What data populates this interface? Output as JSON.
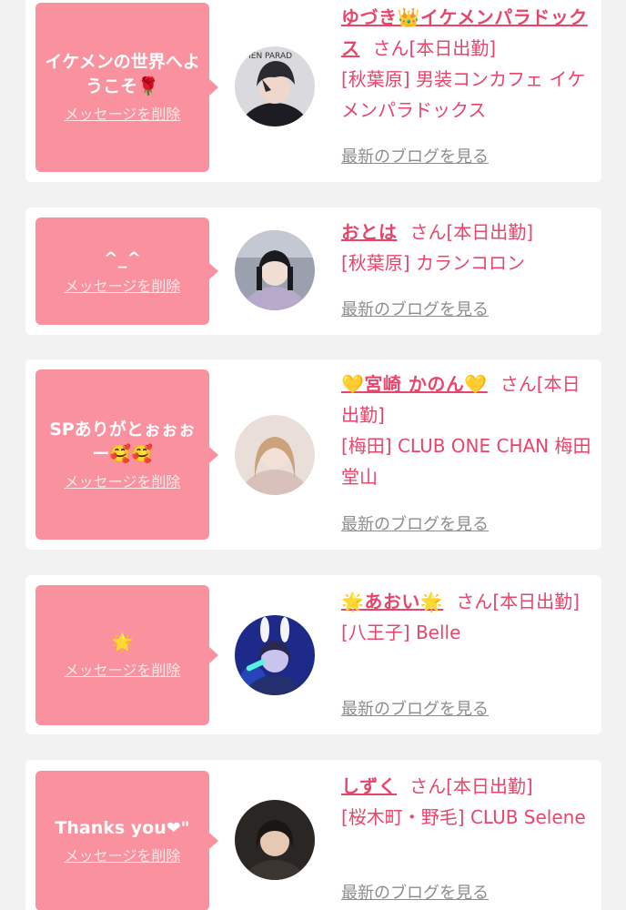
{
  "entries": [
    {
      "message": "イケメンの世界へようこそ🌹",
      "delete_label": "メッセージを削除",
      "name": "ゆづき👑イケメンパラドックス",
      "honorific": "さん",
      "status": "[本日出勤]",
      "shop": "[秋葉原] 男装コンカフェ イケメンパラドックス",
      "blog_label": "最新のブログを見る",
      "avatar_text": "MEN PARAD"
    },
    {
      "message": "^_^",
      "delete_label": "メッセージを削除",
      "name": "おとは",
      "honorific": "さん",
      "status": "[本日出勤]",
      "shop": "[秋葉原] カランコロン",
      "blog_label": "最新のブログを見る"
    },
    {
      "message": "SPありがとぉぉぉー🥰🥰",
      "delete_label": "メッセージを削除",
      "name": "💛宮崎 かのん💛",
      "honorific": "さん",
      "status": "[本日出勤]",
      "shop": "[梅田] CLUB ONE CHAN 梅田堂山",
      "blog_label": "最新のブログを見る"
    },
    {
      "message": "🌟",
      "delete_label": "メッセージを削除",
      "name": "🌟あおい🌟",
      "honorific": "さん",
      "status": "[本日出勤]",
      "shop": "[八王子] Belle",
      "blog_label": "最新のブログを見る"
    },
    {
      "message": "Thanks you❤\"",
      "delete_label": "メッセージを削除",
      "name": "しずく",
      "honorific": "さん",
      "status": "[本日出勤]",
      "shop": "[桜木町・野毛] CLUB Selene",
      "blog_label": "最新のブログを見る"
    }
  ],
  "colors": {
    "background": "#f2f2f3",
    "bubble": "#f9919f",
    "accent_text": "#e8456a",
    "blog_link": "#8d8d8d"
  }
}
